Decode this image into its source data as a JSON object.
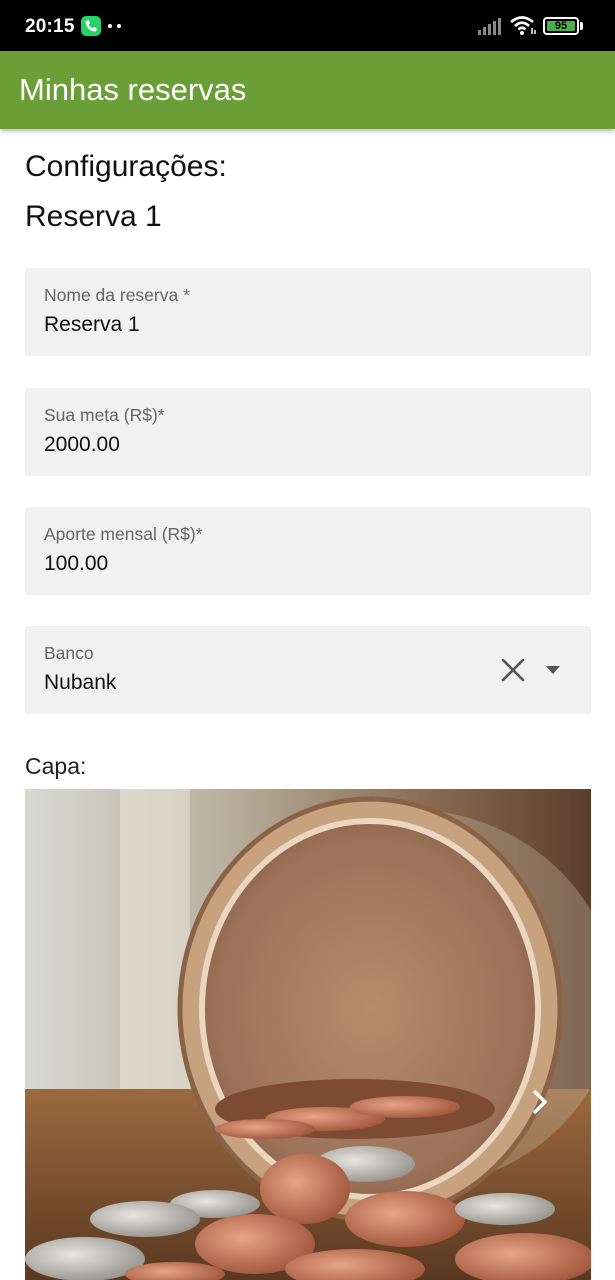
{
  "status_bar": {
    "time": "20:15",
    "battery": "95",
    "icons": [
      "call-icon",
      "more-dots-icon",
      "signal-icon",
      "wifi-icon",
      "battery-icon"
    ]
  },
  "app_bar": {
    "title": "Minhas reservas",
    "color": "#6a9f37"
  },
  "page": {
    "heading": "Configurações:",
    "reserve_name": "Reserva 1"
  },
  "form": {
    "name_field": {
      "label": "Nome da reserva *",
      "value": "Reserva 1"
    },
    "goal_field": {
      "label": "Sua meta (R$)*",
      "value": "2000.00"
    },
    "monthly_field": {
      "label": "Aporte mensal (R$)*",
      "value": "100.00"
    },
    "bank_field": {
      "label": "Banco",
      "value": "Nubank"
    }
  },
  "cover": {
    "label": "Capa:",
    "image_subject": "glass jar spilling coins",
    "next_icon": "chevron-right-icon"
  }
}
